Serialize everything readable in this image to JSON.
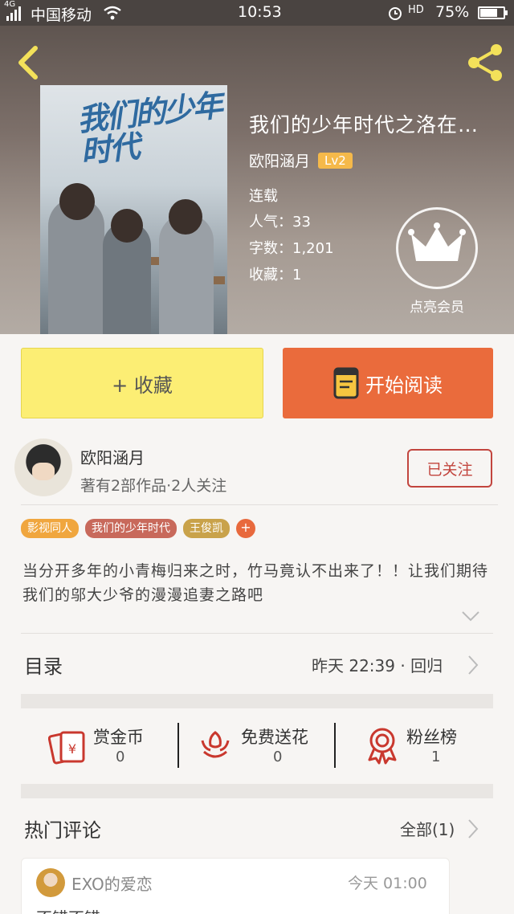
{
  "status_bar": {
    "network": "4G",
    "carrier": "中国移动",
    "time": "10:53",
    "hd": "HD",
    "battery": "75%",
    "battery_level": 0.75
  },
  "book": {
    "title": "我们的少年时代之洛在…",
    "cover_title": "我们的少年时代",
    "author": "欧阳涵月",
    "level": "Lv2",
    "status": "连载",
    "popularity_label": "人气：",
    "popularity": "33",
    "words_label": "字数：",
    "words": "1,201",
    "favorites_label": "收藏：",
    "favorites": "1"
  },
  "vip": {
    "label": "点亮会员"
  },
  "actions": {
    "favorite": "+ 收藏",
    "read": "开始阅读"
  },
  "author_card": {
    "name": "欧阳涵月",
    "meta": "著有2部作品·2人关注",
    "follow": "已关注"
  },
  "tags": [
    {
      "label": "影视同人",
      "color": "#f0a63e"
    },
    {
      "label": "我们的少年时代",
      "color": "#c8695b"
    },
    {
      "label": "王俊凯",
      "color": "#c9a24a"
    }
  ],
  "tag_add": "+",
  "description": "当分开多年的小青梅归来之时，竹马竟认不出来了！！让我们期待我们的邬大少爷的漫漫追妻之路吧",
  "toc": {
    "title": "目录",
    "latest": "昨天 22:39 · 回归"
  },
  "rewards": [
    {
      "label": "赏金币",
      "count": "0",
      "icon": "red-envelope-icon"
    },
    {
      "label": "免费送花",
      "count": "0",
      "icon": "flower-icon"
    },
    {
      "label": "粉丝榜",
      "count": "1",
      "icon": "medal-icon"
    }
  ],
  "hot_comments": {
    "title": "热门评论",
    "all": "全部(1)",
    "items": [
      {
        "user": "EXO的爱恋",
        "time": "今天 01:00",
        "text": "不错不错"
      }
    ]
  },
  "colors": {
    "accent_orange": "#ea6b3c",
    "fav_yellow": "#fcee74",
    "follow_red": "#c2453e",
    "icon_red": "#c9382e"
  }
}
